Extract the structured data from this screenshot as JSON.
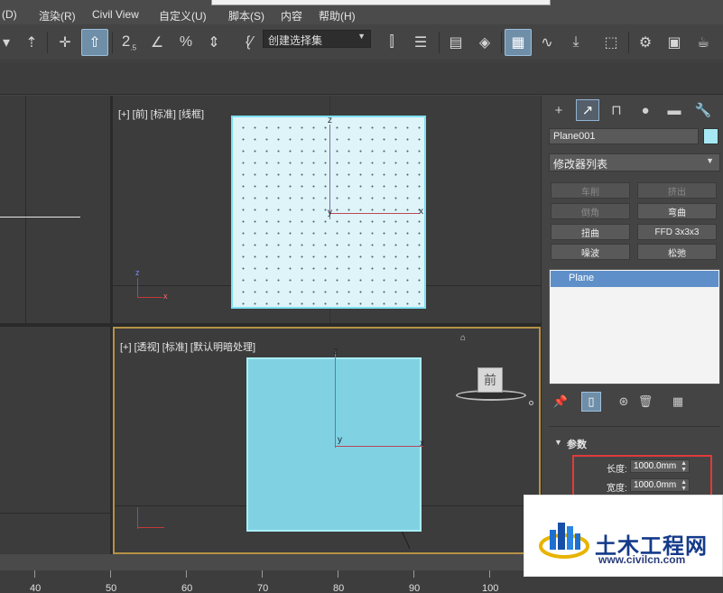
{
  "menu": {
    "items": [
      "(D)",
      "渲染(R)",
      "Civil View",
      "自定义(U)",
      "脚本(S)",
      "内容",
      "帮助(H)"
    ]
  },
  "toolbar": {
    "selection_set": "创建选择集"
  },
  "viewports": {
    "front_label": "[+] [前] [标准] [线框]",
    "persp_label": "[+] [透视] [标准] [默认明暗处理]",
    "viewcube_face": "前",
    "axis_z": "z",
    "axis_x": "x",
    "axis_y": "y"
  },
  "command_panel": {
    "object_name": "Plane001",
    "object_color": "#a6e9f4",
    "modifier_list": "修改器列表",
    "buttons": [
      "车削",
      "挤出",
      "倒角",
      "弯曲",
      "扭曲",
      "FFD 3x3x3",
      "噪波",
      "松弛"
    ],
    "disabled_buttons": [
      "车削",
      "挤出",
      "倒角"
    ],
    "stack_item": "Plane",
    "rollout_title": "参数",
    "params": {
      "length_label": "长度:",
      "length_value": "1000.0mm",
      "width_label": "宽度:",
      "width_value": "1000.0mm"
    }
  },
  "timeline": {
    "ticks": [
      "40",
      "50",
      "60",
      "70",
      "80",
      "90",
      "100"
    ]
  },
  "watermark": {
    "title": "土木工程网",
    "url": "www.civilcn.com"
  },
  "colors": {
    "active_viewport_border": "#b59245",
    "highlight_box": "#e13a3a",
    "plane_front": "#dff4f9",
    "plane_persp": "#80d2e3",
    "stack_selected": "#5f8fc8",
    "brand_blue": "#153a8a"
  }
}
